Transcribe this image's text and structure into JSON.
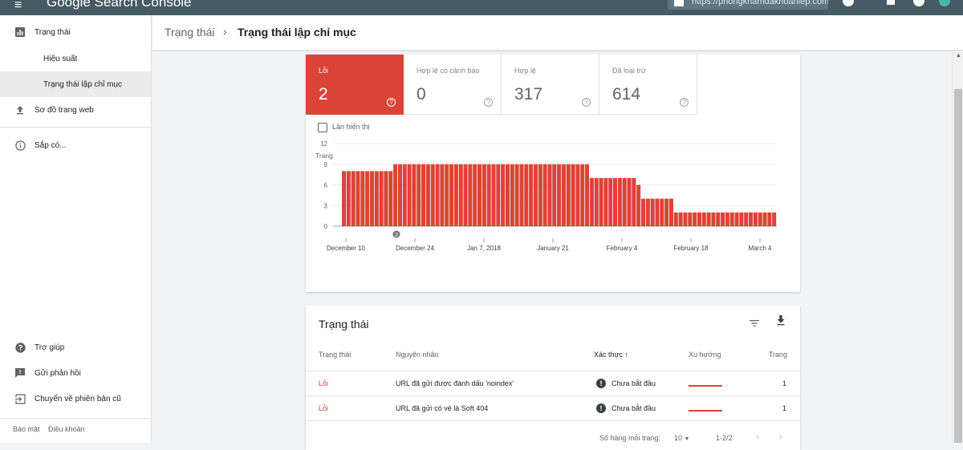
{
  "topbar": {
    "menu_icon": "menu-icon",
    "brand": "Google Search Console",
    "property_url": "https://phongkhamdakhoahiep.com/"
  },
  "sidebar": {
    "items": [
      {
        "label": "Trạng thái",
        "icon": "bar-chart-icon"
      },
      {
        "label": "Hiệu suất"
      },
      {
        "label": "Trạng thái lập chỉ mục"
      },
      {
        "label": "Sơ đồ trang web",
        "icon": "upload-icon"
      },
      {
        "label": "Sắp có...",
        "icon": "info-icon"
      },
      {
        "label": "Trợ giúp",
        "icon": "help-icon"
      },
      {
        "label": "Gửi phản hồi",
        "icon": "feedback-icon"
      },
      {
        "label": "Chuyển về phiên bản cũ",
        "icon": "exit-icon"
      }
    ],
    "footer": {
      "privacy": "Bảo mật",
      "terms": "Điều khoản"
    }
  },
  "breadcrumb": {
    "parent": "Trạng thái",
    "separator": "›",
    "current": "Trạng thái lập chỉ mục"
  },
  "summary": {
    "tiles": [
      {
        "label": "Lỗi",
        "value": "2"
      },
      {
        "label": "Hợp lệ có cảnh báo",
        "value": "0"
      },
      {
        "label": "Hợp lệ",
        "value": "317"
      },
      {
        "label": "Đã loại trừ",
        "value": "614"
      }
    ],
    "help_glyph": "?",
    "impressions_checkbox": "Lần hiển thị"
  },
  "chart_data": {
    "type": "bar",
    "ylabel": "Trang",
    "ylim": [
      0,
      12
    ],
    "yticks": [
      0,
      3,
      6,
      9,
      12
    ],
    "xtick_labels": [
      "December 10",
      "December 24",
      "Jan 7, 2018",
      "January 21",
      "February 4",
      "February 18",
      "March 4"
    ],
    "annotation": "2",
    "color": "#db4437",
    "values": [
      8,
      8,
      8,
      8,
      8,
      8,
      8,
      8,
      8,
      8,
      8,
      9,
      9,
      9,
      9,
      9,
      9,
      9,
      9,
      9,
      9,
      9,
      9,
      9,
      9,
      9,
      9,
      9,
      9,
      9,
      9,
      9,
      9,
      9,
      9,
      9,
      9,
      9,
      9,
      9,
      9,
      9,
      9,
      9,
      9,
      9,
      9,
      9,
      9,
      9,
      9,
      9,
      9,
      7,
      7,
      7,
      7,
      7,
      7,
      7,
      7,
      7,
      7,
      6,
      4,
      4,
      4,
      4,
      4,
      4,
      4,
      2,
      2,
      2,
      2,
      2,
      2,
      2,
      2,
      2,
      2,
      2,
      2,
      2,
      2,
      2,
      2,
      2,
      2,
      2,
      2,
      2,
      2
    ]
  },
  "table": {
    "title": "Trạng thái",
    "icons": [
      "filter-icon",
      "download-icon"
    ],
    "headers": [
      "Trạng thái",
      "Nguyên nhân",
      "Xác thực ↑",
      "Xu hướng",
      "Trang"
    ],
    "rows": [
      {
        "status": "Lỗi",
        "reason": "URL đã gửi được đánh dấu 'noindex'",
        "validation": "Chưa bắt đầu",
        "pages": "1"
      },
      {
        "status": "Lỗi",
        "reason": "URL đã gửi có vẻ là Soft 404",
        "validation": "Chưa bắt đầu",
        "pages": "1"
      }
    ],
    "pager": {
      "rows_label": "Số hàng mỗi trang:",
      "rows_value": "10",
      "range": "1-2/2"
    }
  },
  "colors": {
    "error": "#db4437",
    "topbar": "#455a64"
  }
}
